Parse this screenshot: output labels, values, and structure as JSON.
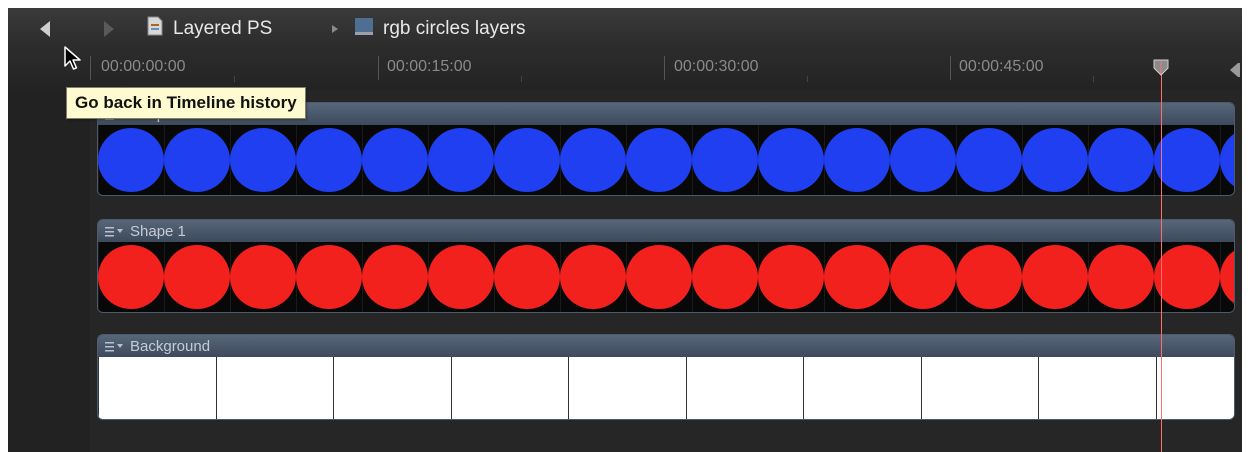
{
  "toolbar": {
    "back_icon": "back-arrow-icon",
    "forward_icon": "forward-arrow-icon",
    "project_name": "Layered PS",
    "project_icon": "document-icon",
    "separator_icon": "breadcrumb-arrow-icon",
    "sequence_name": "rgb circles layers",
    "sequence_icon": "filmstrip-icon"
  },
  "tooltip": {
    "text": "Go back in Timeline history"
  },
  "ruler": {
    "timecodes": [
      "00:00:00:00",
      "00:00:15:00",
      "00:00:30:00",
      "00:00:45:00"
    ]
  },
  "tracks": [
    {
      "name": "Shape 3",
      "content": "blue circles",
      "color": "#1f3ff0"
    },
    {
      "name": "Shape 1",
      "content": "red circles",
      "color": "#f2211d"
    },
    {
      "name": "Background",
      "content": "white frames",
      "color": "#ffffff"
    }
  ],
  "colors": {
    "accent_playhead": "#ff6f6f",
    "tooltip_bg": "#fdfbcf",
    "timeline_bg": "#262626"
  }
}
